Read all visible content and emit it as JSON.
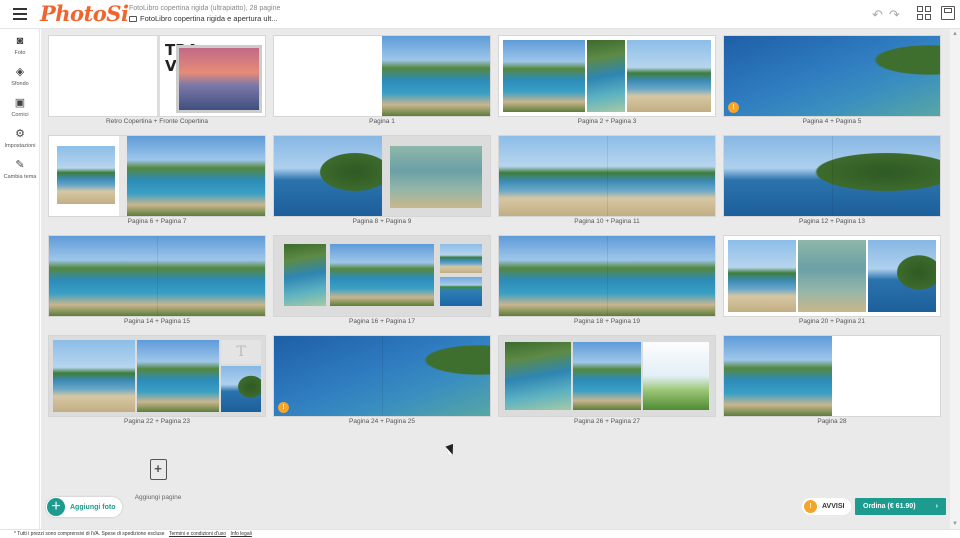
{
  "app": {
    "logo": "PhotoSi"
  },
  "header": {
    "project_info": "FotoLibro copertina rigida (ultrapiatto), 28 pagine",
    "project_name": "FotoLibro copertina rigida e apertura ult...",
    "undo_icon": "undo-icon",
    "redo_icon": "redo-icon",
    "grid_icon": "grid-view-icon",
    "save_icon": "save-icon"
  },
  "sidebar": {
    "items": [
      {
        "label": "Foto",
        "icon": "camera-icon",
        "glyph": "◙"
      },
      {
        "label": "Sfondo",
        "icon": "paint-bucket-icon",
        "glyph": "◈"
      },
      {
        "label": "Cornici",
        "icon": "frame-icon",
        "glyph": "▣"
      },
      {
        "label": "Impostazioni",
        "icon": "gear-icon",
        "glyph": "⚙"
      },
      {
        "label": "Cambia tema",
        "icon": "brush-icon",
        "glyph": "✎"
      }
    ]
  },
  "spreads": [
    {
      "label": "Retro Copertina + Fronte Copertina",
      "cover_text": "TRA VEL",
      "warning": false
    },
    {
      "label": "Pagina 1",
      "warning": false
    },
    {
      "label": "Pagina 2 + Pagina 3",
      "warning": false
    },
    {
      "label": "Pagina 4 + Pagina 5",
      "warning": true
    },
    {
      "label": "Pagina 6 + Pagina 7",
      "warning": false
    },
    {
      "label": "Pagina 8 + Pagina 9",
      "warning": false
    },
    {
      "label": "Pagina 10 + Pagina 11",
      "warning": false
    },
    {
      "label": "Pagina 12 + Pagina 13",
      "warning": false
    },
    {
      "label": "Pagina 14 + Pagina 15",
      "warning": false
    },
    {
      "label": "Pagina 16 + Pagina 17",
      "warning": false
    },
    {
      "label": "Pagina 18 + Pagina 19",
      "warning": false
    },
    {
      "label": "Pagina 20 + Pagina 21",
      "warning": false
    },
    {
      "label": "Pagina 22 + Pagina 23",
      "warning": false
    },
    {
      "label": "Pagina 24 + Pagina 25",
      "warning": true
    },
    {
      "label": "Pagina 26 + Pagina 27",
      "warning": false
    },
    {
      "label": "Pagina 28",
      "warning": false
    }
  ],
  "actions": {
    "add_photo": "Aggiungi foto",
    "add_page": "Aggiungi pagine",
    "warnings": "AVVISI",
    "order": "Ordina (€ 61.90)",
    "order_arrow": "›"
  },
  "footer": {
    "note": "* Tutti i prezzi sono comprensivi di IVA. Spese di spedizione escluse",
    "terms_link": "Termini e condizioni d'uso",
    "legal_link": "Info legali"
  },
  "colors": {
    "brand": "#f0642d",
    "accent": "#1d9b8e",
    "warning": "#f4a52a"
  }
}
